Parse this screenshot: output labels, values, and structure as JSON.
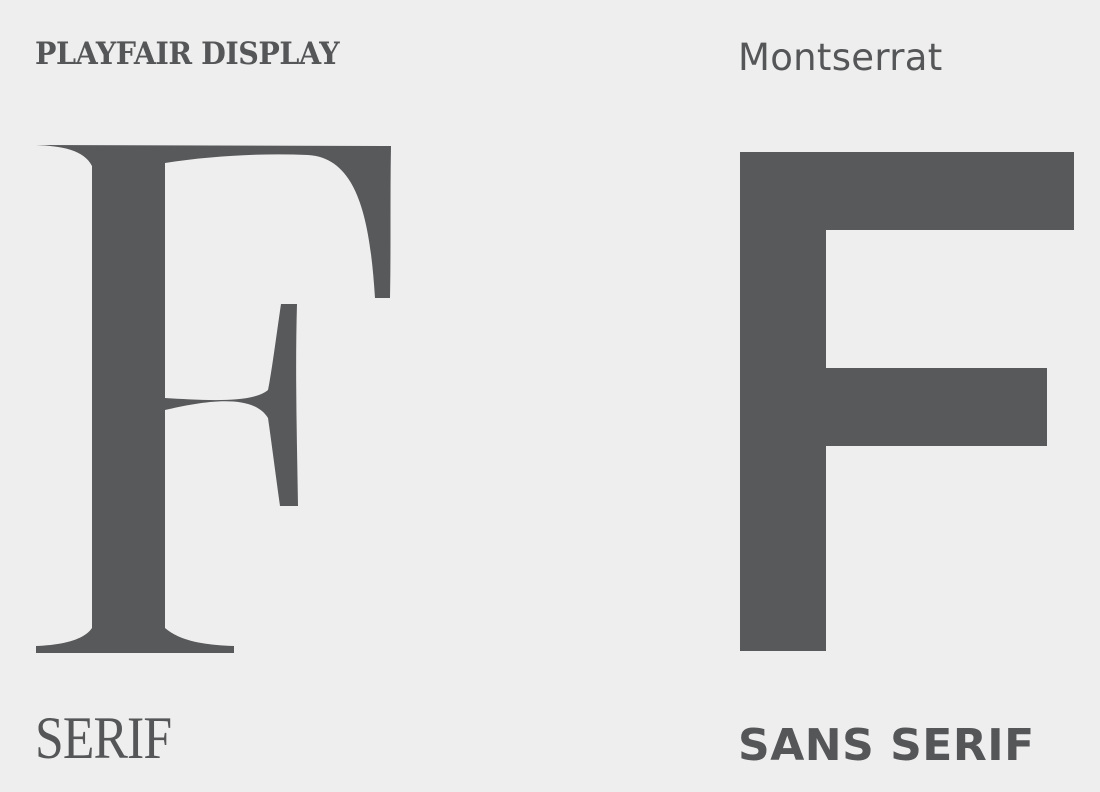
{
  "serif": {
    "font_name": "PLAYFAIR DISPLAY",
    "specimen_letter": "F",
    "category": "SERIF"
  },
  "sans_serif": {
    "font_name": "Montserrat",
    "specimen_letter": "F",
    "category": "SANS SERIF"
  },
  "colors": {
    "background": "#eeeeee",
    "glyph": "#58595b",
    "text": "#555658"
  }
}
